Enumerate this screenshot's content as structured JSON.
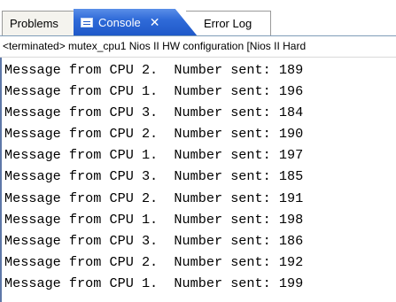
{
  "tabs": [
    {
      "label": "Problems",
      "active": false
    },
    {
      "label": "Console",
      "active": true,
      "close_glyph": "✕"
    },
    {
      "label": "Error Log",
      "active": false
    }
  ],
  "status_line": "<terminated> mutex_cpu1 Nios II HW configuration [Nios II Hard",
  "console_lines": [
    "Message from CPU 2.  Number sent: 189",
    "Message from CPU 1.  Number sent: 196",
    "Message from CPU 3.  Number sent: 184",
    "Message from CPU 2.  Number sent: 190",
    "Message from CPU 1.  Number sent: 197",
    "Message from CPU 3.  Number sent: 185",
    "Message from CPU 2.  Number sent: 191",
    "Message from CPU 1.  Number sent: 198",
    "Message from CPU 3.  Number sent: 186",
    "Message from CPU 2.  Number sent: 192",
    "Message from CPU 1.  Number sent: 199"
  ],
  "colors": {
    "active_tab": "#2f6ad8",
    "border": "#7f9db9"
  },
  "icons": {
    "console_tab": "console-icon",
    "close_tab": "close-icon"
  }
}
